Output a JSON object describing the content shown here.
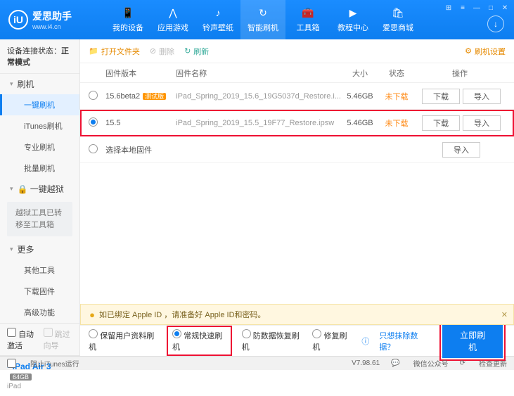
{
  "app": {
    "name": "爱思助手",
    "url": "www.i4.cn",
    "logo_letter": "iU"
  },
  "nav": [
    {
      "label": "我的设备",
      "icon": "📱"
    },
    {
      "label": "应用游戏",
      "icon": "⋀"
    },
    {
      "label": "铃声壁纸",
      "icon": "♪"
    },
    {
      "label": "智能刷机",
      "icon": "↻"
    },
    {
      "label": "工具箱",
      "icon": "🧰"
    },
    {
      "label": "教程中心",
      "icon": "▶"
    },
    {
      "label": "爱思商城",
      "icon": "🛍"
    }
  ],
  "nav_active": 3,
  "sidebar": {
    "status_label": "设备连接状态：",
    "status_value": "正常模式",
    "sections": [
      {
        "head": "刷机",
        "items": [
          "一键刷机",
          "iTunes刷机",
          "专业刷机",
          "批量刷机"
        ],
        "active": 0
      },
      {
        "head": "一键越狱",
        "note": "越狱工具已转移至工具箱"
      },
      {
        "head": "更多",
        "items": [
          "其他工具",
          "下载固件",
          "高级功能"
        ]
      }
    ],
    "auto_activate": "自动激活",
    "skip_guide": "跳过向导",
    "device": {
      "name": "iPad Air 3",
      "storage": "64GB",
      "type": "iPad"
    }
  },
  "toolbar": {
    "open_folder": "打开文件夹",
    "delete": "删除",
    "refresh": "刷新",
    "settings": "刷机设置"
  },
  "table": {
    "headers": {
      "version": "固件版本",
      "name": "固件名称",
      "size": "大小",
      "status": "状态",
      "ops": "操作"
    },
    "rows": [
      {
        "version": "15.6beta2",
        "tag": "测试版",
        "name": "iPad_Spring_2019_15.6_19G5037d_Restore.i...",
        "size": "5.46GB",
        "status": "未下载",
        "checked": false,
        "highlight": false
      },
      {
        "version": "15.5",
        "tag": "",
        "name": "iPad_Spring_2019_15.5_19F77_Restore.ipsw",
        "size": "5.46GB",
        "status": "未下载",
        "checked": true,
        "highlight": true
      }
    ],
    "local_firmware": "选择本地固件",
    "btn_download": "下载",
    "btn_import": "导入"
  },
  "notice": "如已绑定 Apple ID ，请准备好 Apple ID和密码。",
  "options": {
    "opt1": "保留用户资料刷机",
    "opt2": "常规快速刷机",
    "opt3": "防数据恢复刷机",
    "opt4": "修复刷机",
    "link": "只想抹除数据？",
    "action": "立即刷机"
  },
  "footer": {
    "block_itunes": "阻止iTunes运行",
    "version": "V7.98.61",
    "wechat": "微信公众号",
    "check_update": "检查更新"
  }
}
